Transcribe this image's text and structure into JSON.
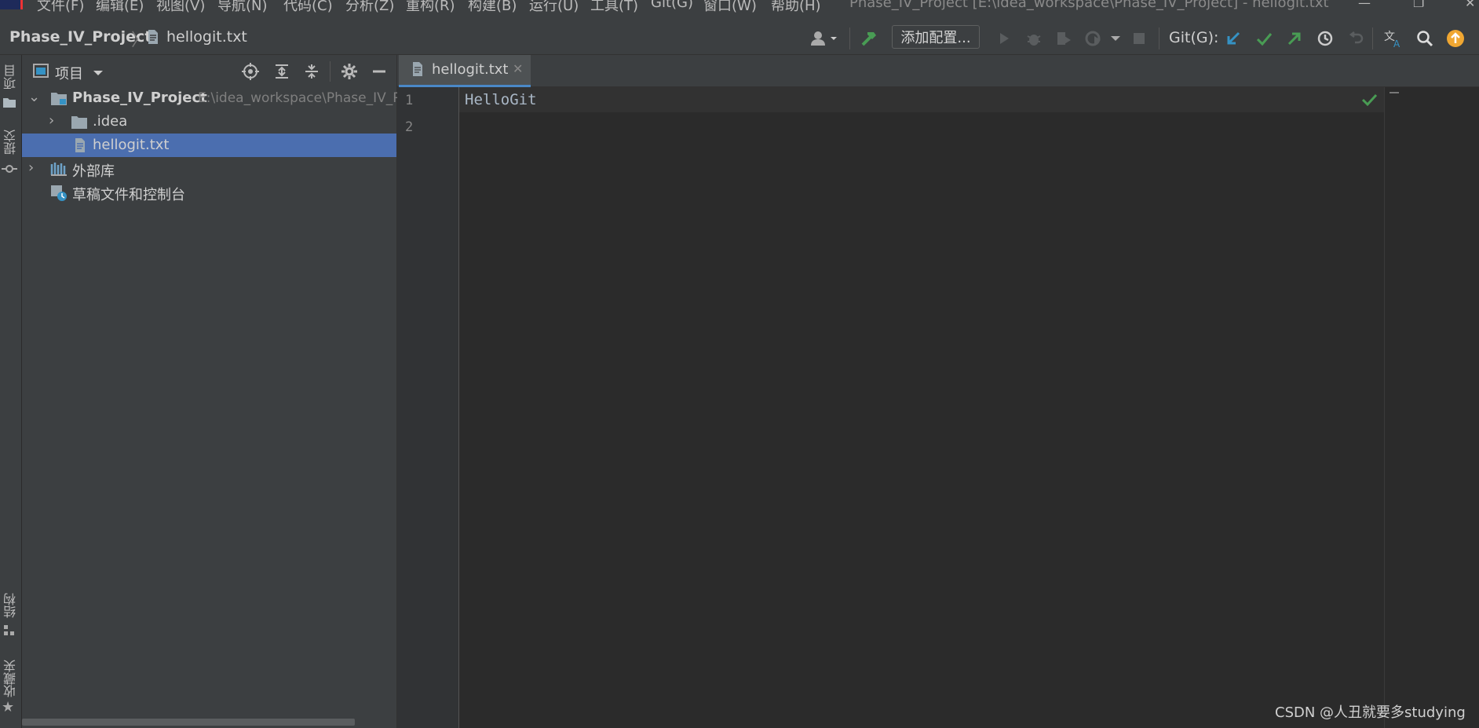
{
  "menu": {
    "items": [
      "文件(F)",
      "编辑(E)",
      "视图(V)",
      "导航(N)",
      "代码(C)",
      "分析(Z)",
      "重构(R)",
      "构建(B)",
      "运行(U)",
      "工具(T)",
      "Git(G)",
      "窗口(W)",
      "帮助(H)"
    ],
    "window_title": "Phase_IV_Project [E:\\idea_workspace\\Phase_IV_Project] - hellogit.txt"
  },
  "navbar": {
    "project": "Phase_IV_Project",
    "file": "hellogit.txt",
    "add_config": "添加配置...",
    "git_label": "Git(G):"
  },
  "left_strip": {
    "tabs": [
      "项目",
      "提交",
      "结构",
      "收藏夹"
    ]
  },
  "project_panel": {
    "title": "项目",
    "tree": [
      {
        "label": "Phase_IV_Project",
        "path": "E:\\idea_workspace\\Phase_IV_P"
      },
      {
        "label": ".idea"
      },
      {
        "label": "hellogit.txt"
      },
      {
        "label": "外部库"
      },
      {
        "label": "草稿文件和控制台"
      }
    ]
  },
  "editor": {
    "tab_label": "hellogit.txt",
    "line_numbers": [
      "1",
      "2"
    ],
    "lines": [
      "HelloGit"
    ]
  },
  "watermark": "CSDN @人丑就要多studying",
  "colors": {
    "accent": "#4b6eaf",
    "tab_underline": "#4a88c7",
    "git_green": "#499c54",
    "git_blue": "#3592c4",
    "orange_badge": "#f0a732"
  }
}
